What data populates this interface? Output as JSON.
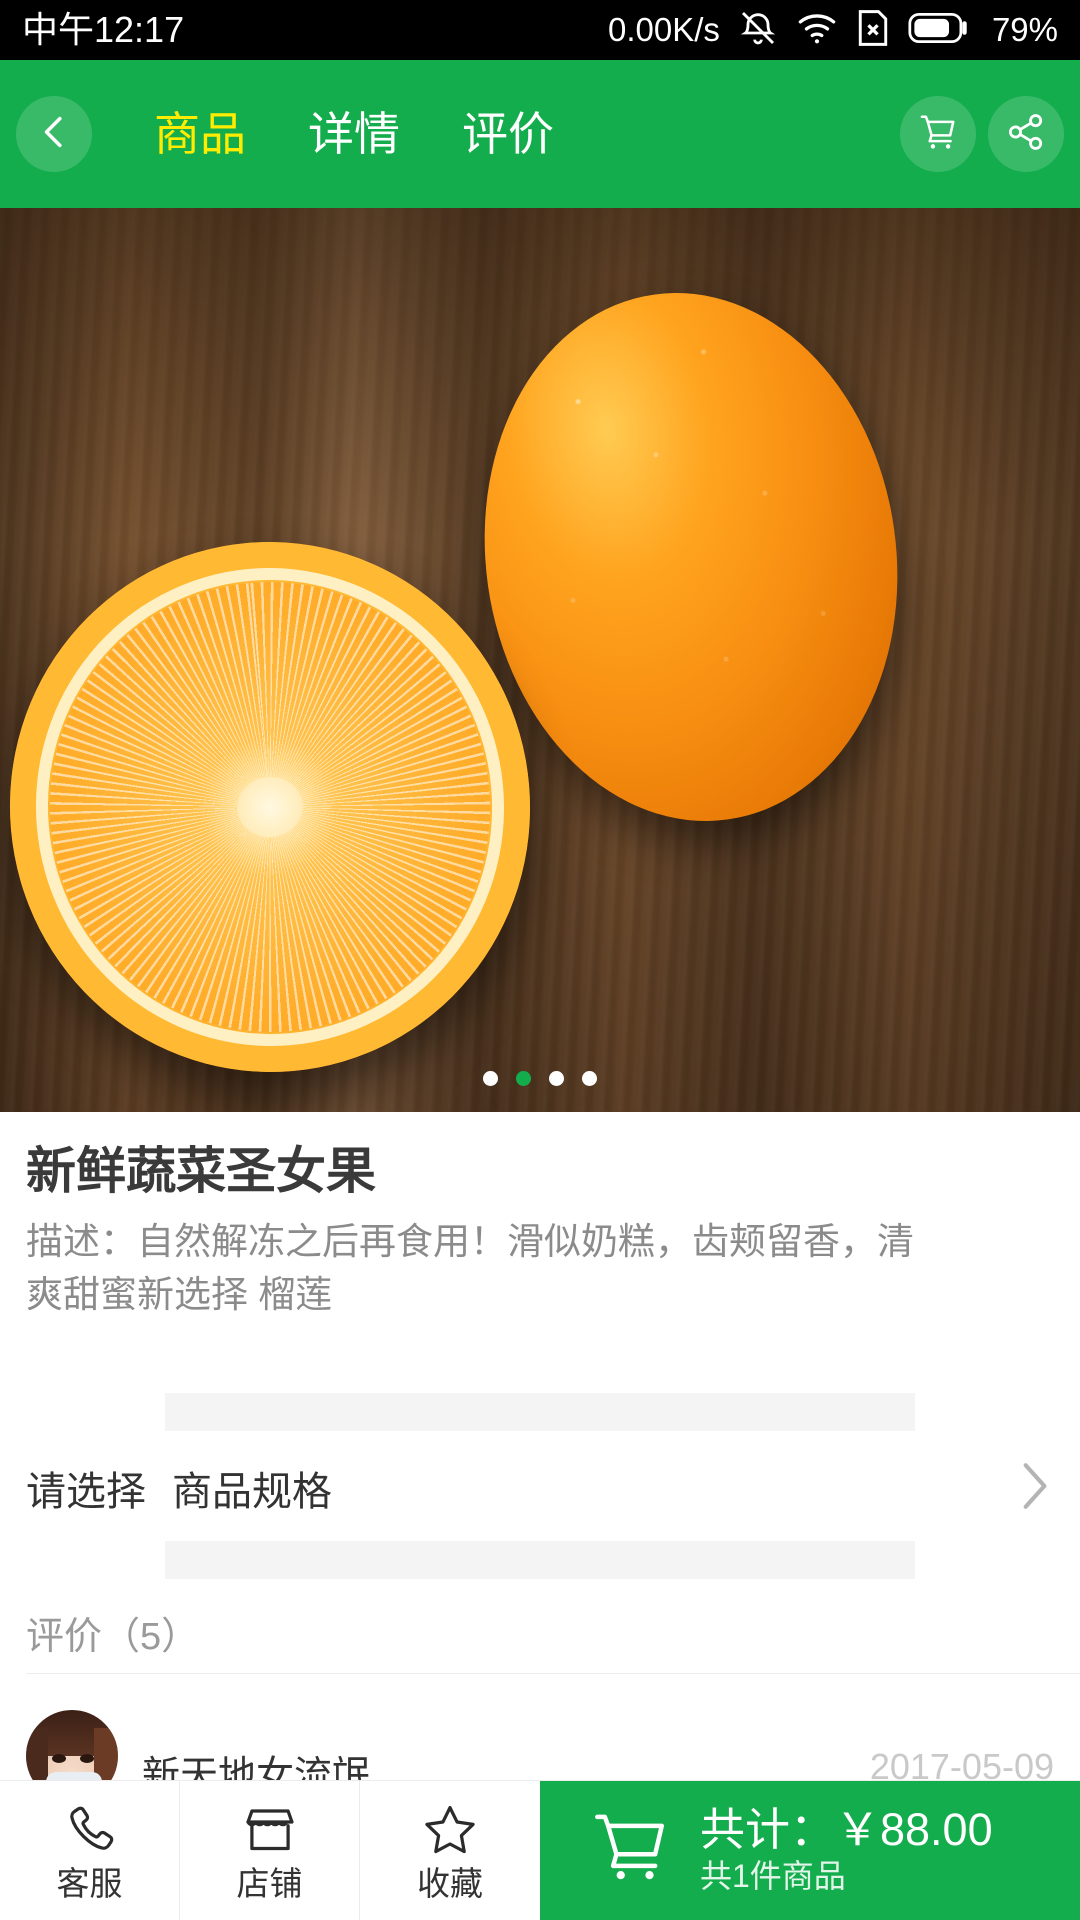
{
  "status_bar": {
    "clock": "中午12:17",
    "network_speed": "0.00K/s",
    "battery_percent": "79%",
    "icons": [
      "mute-icon",
      "wifi-icon",
      "sim-card-x-icon",
      "battery-icon"
    ]
  },
  "header": {
    "back_icon": "chevron-left-icon",
    "tabs": [
      {
        "label": "商品",
        "active": true
      },
      {
        "label": "详情",
        "active": false
      },
      {
        "label": "评价",
        "active": false
      }
    ],
    "actions": [
      {
        "name": "cart-icon",
        "label": "购物车"
      },
      {
        "name": "share-icon",
        "label": "分享"
      }
    ],
    "background_color": "#14ad4d",
    "active_tab_color": "#ffec00"
  },
  "carousel": {
    "image_alt": "两个橙子放在木桌上",
    "dot_count": 4,
    "active_index": 1,
    "active_dot_color": "#14ad4d"
  },
  "product": {
    "title": "新鲜蔬菜圣女果",
    "description": "描述：自然解冻之后再食用！滑似奶糕，齿颊留香，清爽甜蜜新选择 榴莲"
  },
  "spec": {
    "label": "请选择",
    "value": "商品规格",
    "chevron_icon": "chevron-right-icon"
  },
  "reviews": {
    "header": "评价（5）",
    "count": 5,
    "items": [
      {
        "username": "新天地女流氓",
        "date": "2017-05-09",
        "avatar": "user-avatar"
      }
    ]
  },
  "bottom_bar": {
    "actions": [
      {
        "label": "客服",
        "icon": "phone-icon"
      },
      {
        "label": "店铺",
        "icon": "shop-icon"
      },
      {
        "label": "收藏",
        "icon": "star-icon"
      }
    ],
    "checkout": {
      "icon": "cart-icon",
      "total_label": "共计：￥88.00",
      "count_label": "共1件商品",
      "background_color": "#14ad4d"
    }
  }
}
